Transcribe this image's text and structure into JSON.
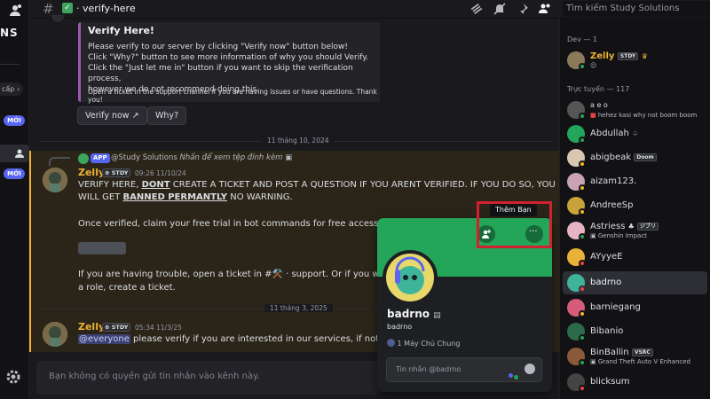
{
  "left": {
    "server_abbrev": "NS",
    "level_chip": "cấp",
    "new_badge": "MỚI"
  },
  "header": {
    "channel": "verify-here",
    "search_placeholder": "Tìm kiếm Study Solutions"
  },
  "embed": {
    "title": "Verify Here!",
    "body_lines": [
      "Please verify to our server by clicking \"Verify now\" button below!",
      "Click \"Why?\" button to see more information of why you should Verify.",
      "Click the \"Just let me in\" button if you want to skip the verification process,",
      "however we do not recommend doing this."
    ],
    "footer": "Open a ticket in the support channel if you are having issues or have questions. Thank you!",
    "btn_verify": "Verify now",
    "btn_why": "Why?"
  },
  "dividers": {
    "d1": "11 tháng 10, 2024",
    "d2": "11 tháng 3, 2025"
  },
  "pinned_notice": {
    "app_tag": "APP",
    "author": "@Study Solutions",
    "text": "Nhấn để xem tệp đính kèm"
  },
  "msg1": {
    "author": "Zelly",
    "tag": "STDY",
    "time": "09:26 11/10/24",
    "line1": "VERIFY HERE, ",
    "line1_u": "DONT",
    "line1_rest": " CREATE A TICKET AND POST A QUESTION IF YOU ARENT VERIFIED. IF YOU DO SO, YOU",
    "line2_pre": "WILL GET ",
    "line2_u": "BANNED PERMANTLY",
    "line2_rest": " NO WARNING.",
    "line3": "Once verified, claim your free trial in bot commands for free access tempora",
    "line4_pre": "If you are having trouble, open a ticket in #",
    "line4_mid": "⚒️",
    "line4_rest": " · support. Or if you want to sk",
    "line5": "a role, create a ticket."
  },
  "msg2": {
    "author": "Zelly",
    "tag": "STDY",
    "time": "05:34 11/3/25",
    "mention": "@everyone",
    "text": " please verify if you are interested in our services, if not feel free"
  },
  "composer": {
    "placeholder": "Bạn không có quyền gửi tin nhắn vào kênh này."
  },
  "popup": {
    "tooltip": "Thêm Bạn",
    "display_name": "badrno",
    "username": "badrno",
    "mutual": "1 Máy Chủ Chung",
    "input_placeholder": "Tin nhắn @badrno"
  },
  "members": {
    "section_dev": "Dev — 1",
    "section_online": "Trực tuyến — 117",
    "list": [
      {
        "name": "Zelly",
        "tag": "STDY",
        "status": "",
        "color": "#f0b232"
      },
      {
        "name": "a e o",
        "tag": "",
        "status": "hehez kasi why not boom boom",
        "color": "#dbdee1"
      },
      {
        "name": "Abdullah",
        "tag": "",
        "status": "",
        "color": "#dbdee1"
      },
      {
        "name": "abigbeak",
        "tag": "",
        "status": "Doom",
        "color": "#dbdee1"
      },
      {
        "name": "aizam123.",
        "tag": "",
        "status": "",
        "color": "#dbdee1"
      },
      {
        "name": "AndreeSp",
        "tag": "",
        "status": "",
        "color": "#dbdee1"
      },
      {
        "name": "Astriess",
        "tag": "ジブリ",
        "status": "Genshin Impact",
        "color": "#dbdee1"
      },
      {
        "name": "AYyyeE",
        "tag": "",
        "status": "",
        "color": "#dbdee1"
      },
      {
        "name": "badrno",
        "tag": "",
        "status": "",
        "color": "#f2f3f5"
      },
      {
        "name": "barniegang",
        "tag": "",
        "status": "",
        "color": "#dbdee1"
      },
      {
        "name": "Bibanio",
        "tag": "",
        "status": "",
        "color": "#dbdee1"
      },
      {
        "name": "BinBallin",
        "tag": "VSRC",
        "status": "Grand Theft Auto V Enhanced",
        "color": "#dbdee1"
      },
      {
        "name": "blicksum",
        "tag": "",
        "status": "",
        "color": "#dbdee1"
      }
    ]
  },
  "colors": {
    "accent": "#5865f2",
    "online": "#23a55a",
    "highlight": "#f0b232",
    "callout": "#d2202f"
  }
}
